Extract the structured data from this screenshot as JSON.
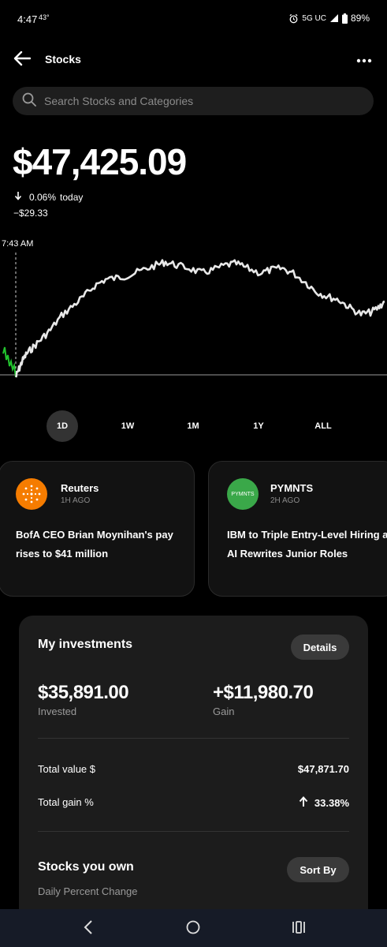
{
  "status_bar": {
    "time": "4:47",
    "temperature": "43°",
    "network": "5G UC",
    "battery": "89%",
    "icons": [
      "alarm-icon",
      "signal-icon",
      "battery-icon"
    ]
  },
  "header": {
    "title": "Stocks",
    "back_icon": "arrow-left-icon",
    "menu_icon": "more-horizontal-icon"
  },
  "search": {
    "placeholder": "Search Stocks and Categories",
    "icon": "search-icon"
  },
  "portfolio": {
    "value": "$47,425.09",
    "change_percent": "0.06%",
    "change_period": "today",
    "change_amount": "−$29.33",
    "direction": "down"
  },
  "chart": {
    "start_label": "7:43 AM",
    "line_color": "#e8e8e8",
    "start_color": "#22c32e",
    "baseline_color": "#a0a0a0"
  },
  "time_ranges": {
    "options": [
      "1D",
      "1W",
      "1M",
      "1Y",
      "ALL"
    ],
    "selected": "1D"
  },
  "news": [
    {
      "source": "Reuters",
      "age": "1H AGO",
      "headline": "BofA CEO Brian Moynihan's pay rises to $41 million",
      "logo_color": "#f57c00"
    },
    {
      "source": "PYMNTS",
      "age": "2H AGO",
      "headline": "IBM to Triple Entry-Level Hiring as AI Rewrites Junior Roles",
      "logo_color": "#3aa849",
      "logo_text": "PYMNTS"
    }
  ],
  "investments": {
    "title": "My investments",
    "details_label": "Details",
    "invested_value": "$35,891.00",
    "invested_label": "Invested",
    "gain_value": "+$11,980.70",
    "gain_label": "Gain",
    "total_value_label": "Total value $",
    "total_value": "$47,871.70",
    "total_gain_label": "Total gain %",
    "total_gain": "33.38%",
    "stocks_title": "Stocks you own",
    "sort_label": "Sort By",
    "stocks_subtitle": "Daily Percent Change"
  },
  "nav_bar": {
    "buttons": [
      "back-icon",
      "home-icon",
      "recents-icon"
    ]
  }
}
